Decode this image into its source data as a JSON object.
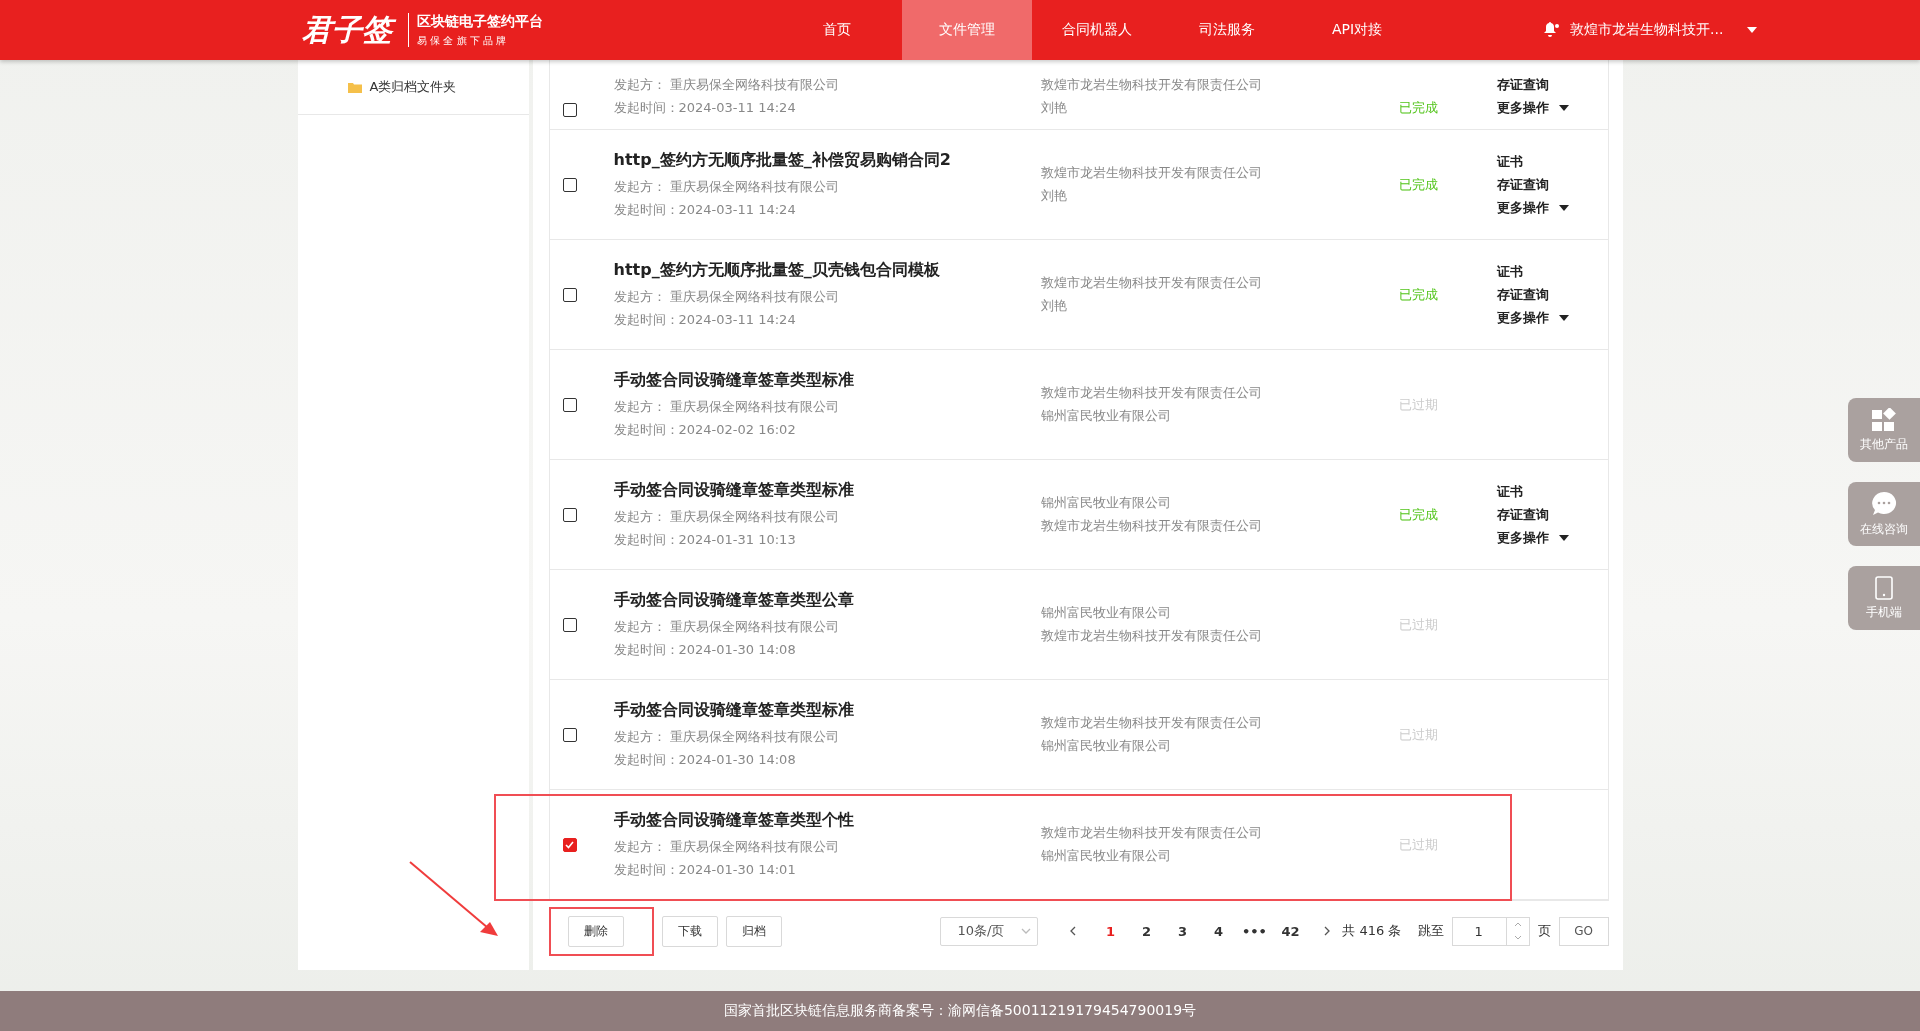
{
  "header": {
    "logo": "君子签",
    "tagline": "区块链电子签约平台",
    "slogan": "易 保 全 旗 下 品 牌",
    "nav": [
      {
        "label": "首页",
        "selected": false
      },
      {
        "label": "文件管理",
        "selected": true
      },
      {
        "label": "合同机器人",
        "selected": false
      },
      {
        "label": "司法服务",
        "selected": false
      },
      {
        "label": "API对接",
        "selected": false
      }
    ],
    "user": "敦煌市龙岩生物科技开..."
  },
  "sidebar": {
    "folders": [
      "A类归档文件夹"
    ]
  },
  "rows": [
    {
      "kind": "partial",
      "sender": "发起方：  重庆易保全网络科技有限公司",
      "time": "发起时间：2024-03-11 14:24",
      "parties": [
        "敦煌市龙岩生物科技开发有限责任公司",
        "刘艳"
      ],
      "status": "已完成",
      "expired": false,
      "actions": [
        "存证查询",
        "更多操作"
      ],
      "checked": false,
      "highlighted": false
    },
    {
      "kind": "full",
      "title": "http_签约方无顺序批量签_补偿贸易购销合同2",
      "sender": "发起方：  重庆易保全网络科技有限公司",
      "time": "发起时间：2024-03-11 14:24",
      "parties": [
        "敦煌市龙岩生物科技开发有限责任公司",
        "刘艳"
      ],
      "status": "已完成",
      "expired": false,
      "actions": [
        "证书",
        "存证查询",
        "更多操作"
      ],
      "checked": false,
      "highlighted": false
    },
    {
      "kind": "full",
      "title": "http_签约方无顺序批量签_贝壳钱包合同模板",
      "sender": "发起方：  重庆易保全网络科技有限公司",
      "time": "发起时间：2024-03-11 14:24",
      "parties": [
        "敦煌市龙岩生物科技开发有限责任公司",
        "刘艳"
      ],
      "status": "已完成",
      "expired": false,
      "actions": [
        "证书",
        "存证查询",
        "更多操作"
      ],
      "checked": false,
      "highlighted": false
    },
    {
      "kind": "full",
      "title": "手动签合同设骑缝章签章类型标准",
      "sender": "发起方：  重庆易保全网络科技有限公司",
      "time": "发起时间：2024-02-02 16:02",
      "parties": [
        "敦煌市龙岩生物科技开发有限责任公司",
        "锦州富民牧业有限公司"
      ],
      "status": "已过期",
      "expired": true,
      "actions": [],
      "checked": false,
      "highlighted": false
    },
    {
      "kind": "full",
      "title": "手动签合同设骑缝章签章类型标准",
      "sender": "发起方：  重庆易保全网络科技有限公司",
      "time": "发起时间：2024-01-31 10:13",
      "parties": [
        "锦州富民牧业有限公司",
        "敦煌市龙岩生物科技开发有限责任公司"
      ],
      "status": "已完成",
      "expired": false,
      "actions": [
        "证书",
        "存证查询",
        "更多操作"
      ],
      "checked": false,
      "highlighted": false
    },
    {
      "kind": "full",
      "title": "手动签合同设骑缝章签章类型公章",
      "sender": "发起方：  重庆易保全网络科技有限公司",
      "time": "发起时间：2024-01-30 14:08",
      "parties": [
        "锦州富民牧业有限公司",
        "敦煌市龙岩生物科技开发有限责任公司"
      ],
      "status": "已过期",
      "expired": true,
      "actions": [],
      "checked": false,
      "highlighted": false
    },
    {
      "kind": "full",
      "title": "手动签合同设骑缝章签章类型标准",
      "sender": "发起方：  重庆易保全网络科技有限公司",
      "time": "发起时间：2024-01-30 14:08",
      "parties": [
        "敦煌市龙岩生物科技开发有限责任公司",
        "锦州富民牧业有限公司"
      ],
      "status": "已过期",
      "expired": true,
      "actions": [],
      "checked": false,
      "highlighted": false
    },
    {
      "kind": "full",
      "title": "手动签合同设骑缝章签章类型个性",
      "sender": "发起方：  重庆易保全网络科技有限公司",
      "time": "发起时间：2024-01-30 14:01",
      "parties": [
        "敦煌市龙岩生物科技开发有限责任公司",
        "锦州富民牧业有限公司"
      ],
      "status": "已过期",
      "expired": true,
      "actions": [],
      "checked": true,
      "highlighted": true
    }
  ],
  "bulk_buttons": [
    {
      "label": "删除",
      "highlighted": true
    },
    {
      "label": "下载",
      "highlighted": false
    },
    {
      "label": "归档",
      "highlighted": false
    }
  ],
  "pagination": {
    "page_size": "10条/页",
    "pages": [
      {
        "label": "1",
        "selected": true
      },
      {
        "label": "2",
        "selected": false
      },
      {
        "label": "3",
        "selected": false
      },
      {
        "label": "4",
        "selected": false
      },
      {
        "label": "•••",
        "selected": false
      },
      {
        "label": "42",
        "selected": false
      }
    ],
    "total": "共 416 条",
    "jump_label": "跳至",
    "jump_value": "1",
    "page_unit": "页",
    "go": "GO"
  },
  "float_buttons": [
    {
      "kind": "grid",
      "label": "其他产品"
    },
    {
      "kind": "chat",
      "label": "在线咨询"
    },
    {
      "kind": "phone",
      "label": "手机端"
    }
  ],
  "footer": "国家首批区块链信息服务商备案号：渝网信备50011219179454790019号"
}
